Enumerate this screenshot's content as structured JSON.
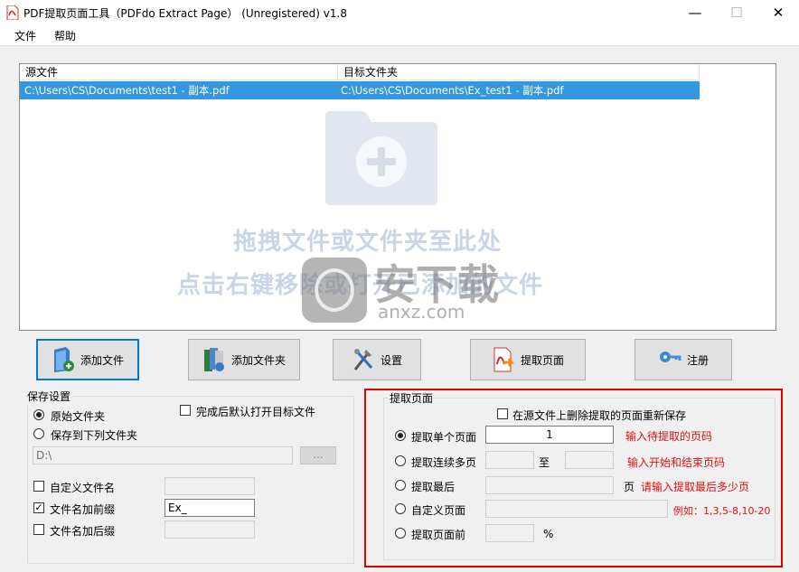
{
  "window": {
    "title": "PDF提取页面工具（PDFdo Extract Page） (Unregistered) v1.8",
    "min_symbol": "—",
    "max_symbol": "☐",
    "close_symbol": "✕"
  },
  "menu": [
    "文件",
    "帮助"
  ],
  "file_list": {
    "columns": [
      "源文件",
      "目标文件夹"
    ],
    "rows": [
      {
        "source": "C:\\Users\\CS\\Documents\\test1 - 副本.pdf",
        "target": "C:\\Users\\CS\\Documents\\Ex_test1 - 副本.pdf"
      }
    ],
    "hint_line1": "拖拽文件或文件夹至此处",
    "hint_line2": "点击右键移除或打开已添加的文件"
  },
  "watermark": {
    "text": "安下载",
    "sub": "anxz.com"
  },
  "toolbar": {
    "add_file": "添加文件",
    "add_folder": "添加文件夹",
    "settings": "设置",
    "extract": "提取页面",
    "register": "注册"
  },
  "save_settings": {
    "title": "保存设置",
    "original_folder": "原始文件夹",
    "save_to_folder": "保存到下列文件夹",
    "open_after": "完成后默认打开目标文件",
    "folder_path": "D:\\",
    "browse": "...",
    "custom_name": "自定义文件名",
    "prefix": "文件名加前缀",
    "prefix_value": "Ex_",
    "suffix": "文件名加后缀"
  },
  "extract_settings": {
    "title": "提取页面",
    "delete_resave": "在源文件上删除提取的页面重新保存",
    "single_page": "提取单个页面",
    "single_value": "1",
    "single_hint": "输入待提取的页码",
    "range": "提取连续多页",
    "range_to": "至",
    "range_hint": "输入开始和结束页码",
    "last": "提取最后",
    "last_unit": "页",
    "last_hint": "请输入提取最后多少页",
    "custom": "自定义页面",
    "custom_hint": "例如：1,3,5-8,10-20",
    "front": "提取页面前",
    "front_unit": "%"
  },
  "colors": {
    "selection": "#3398e0",
    "highlight_border": "#e00000",
    "hint_text": "#e01010"
  }
}
